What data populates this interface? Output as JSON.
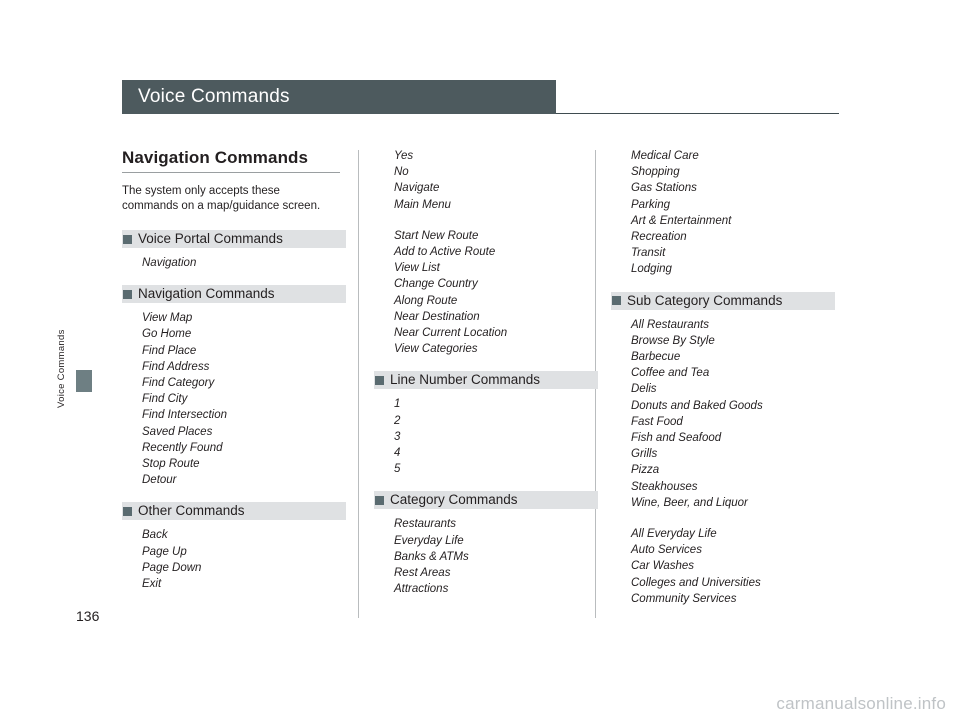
{
  "page": {
    "title": "Voice Commands",
    "side_tab_label": "Voice Commands",
    "number": "136",
    "watermark": "carmanualsonline.info"
  },
  "column1": {
    "section_title": "Navigation Commands",
    "intro": "The system only accepts these commands on a map/guidance screen.",
    "groups": [
      {
        "heading": "Voice Portal Commands",
        "items": [
          "Navigation"
        ]
      },
      {
        "heading": "Navigation Commands",
        "items": [
          "View Map",
          "Go Home",
          "Find Place",
          "Find Address",
          "Find Category",
          "Find City",
          "Find Intersection",
          "Saved Places",
          "Recently Found",
          "Stop Route",
          "Detour"
        ]
      },
      {
        "heading": "Other Commands",
        "items": [
          "Back",
          "Page Up",
          "Page Down",
          "Exit"
        ]
      }
    ]
  },
  "column2": {
    "top_items": [
      "Yes",
      "No",
      "Navigate",
      "Main Menu",
      "",
      "Start New Route",
      "Add to Active Route",
      "View List",
      "Change Country",
      "Along Route",
      "Near Destination",
      "Near Current Location",
      "View Categories"
    ],
    "groups": [
      {
        "heading": "Line Number Commands",
        "items": [
          "1",
          "2",
          "3",
          "4",
          "5"
        ]
      },
      {
        "heading": "Category Commands",
        "items": [
          "Restaurants",
          "Everyday Life",
          "Banks & ATMs",
          "Rest Areas",
          "Attractions"
        ]
      }
    ]
  },
  "column3": {
    "top_items": [
      "Medical Care",
      "Shopping",
      "Gas Stations",
      "Parking",
      "Art & Entertainment",
      "Recreation",
      "Transit",
      "Lodging"
    ],
    "groups": [
      {
        "heading": "Sub Category Commands",
        "items": [
          "All Restaurants",
          "Browse By Style",
          "Barbecue",
          "Coffee and Tea",
          "Delis",
          "Donuts and Baked Goods",
          "Fast Food",
          "Fish and Seafood",
          "Grills",
          "Pizza",
          "Steakhouses",
          "Wine, Beer, and Liquor",
          "",
          "All Everyday Life",
          "Auto Services",
          "Car Washes",
          "Colleges and Universities",
          "Community Services"
        ]
      }
    ]
  }
}
